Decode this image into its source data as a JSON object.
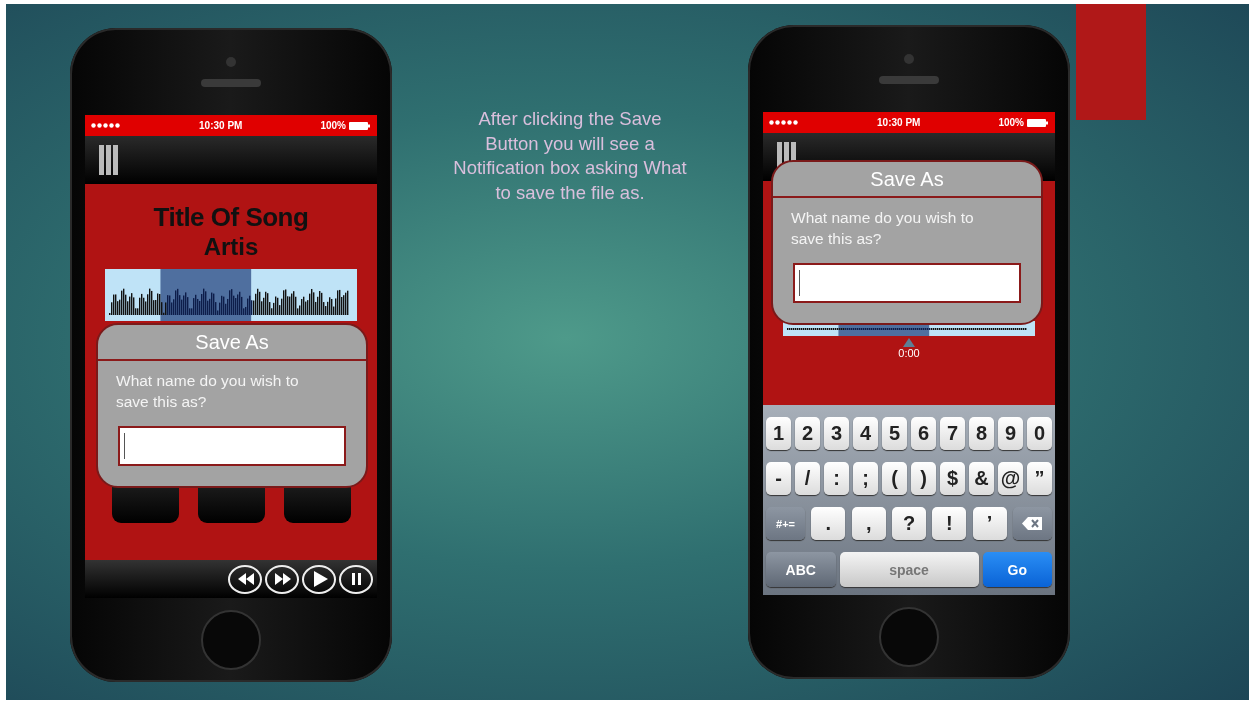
{
  "caption": "After clicking the Save Button you will see a Notification box asking What to save the file as.",
  "phones": [
    {
      "kind": "player",
      "status": {
        "time": "10:30 PM",
        "battery": "100%"
      },
      "song": {
        "title": "Title Of Song",
        "artist": "Artis"
      },
      "dialog": {
        "title": "Save As",
        "prompt": "What name do you wish to save this as?"
      }
    },
    {
      "kind": "keyboard",
      "status": {
        "time": "10:30 PM",
        "battery": "100%"
      },
      "time_marker": "0:00",
      "dialog": {
        "title": "Save As",
        "prompt": "What name do you wish to save this as?"
      },
      "keyboard": {
        "rows": [
          {
            "keys": [
              {
                "kind": "char",
                "label": "1"
              },
              {
                "kind": "char",
                "label": "2"
              },
              {
                "kind": "char",
                "label": "3"
              },
              {
                "kind": "char",
                "label": "4"
              },
              {
                "kind": "char",
                "label": "5"
              },
              {
                "kind": "char",
                "label": "6"
              },
              {
                "kind": "char",
                "label": "7"
              },
              {
                "kind": "char",
                "label": "8"
              },
              {
                "kind": "char",
                "label": "9"
              },
              {
                "kind": "char",
                "label": "0"
              }
            ]
          },
          {
            "keys": [
              {
                "kind": "char",
                "label": "-"
              },
              {
                "kind": "char",
                "label": "/"
              },
              {
                "kind": "char",
                "label": ":"
              },
              {
                "kind": "char",
                "label": ";"
              },
              {
                "kind": "char",
                "label": "("
              },
              {
                "kind": "char",
                "label": ")"
              },
              {
                "kind": "char",
                "label": "$"
              },
              {
                "kind": "char",
                "label": "&"
              },
              {
                "kind": "char",
                "label": "@"
              },
              {
                "kind": "char",
                "label": "”"
              }
            ]
          },
          {
            "keys": [
              {
                "kind": "mode",
                "label": "#+="
              },
              {
                "kind": "wide",
                "label": "."
              },
              {
                "kind": "wide",
                "label": ","
              },
              {
                "kind": "wide",
                "label": "?"
              },
              {
                "kind": "wide",
                "label": "!"
              },
              {
                "kind": "wide",
                "label": "’"
              },
              {
                "kind": "delete"
              }
            ]
          },
          {
            "keys": [
              {
                "kind": "abc",
                "label": "ABC"
              },
              {
                "kind": "space",
                "label": "space"
              },
              {
                "kind": "go",
                "label": "Go"
              }
            ]
          }
        ]
      }
    }
  ]
}
